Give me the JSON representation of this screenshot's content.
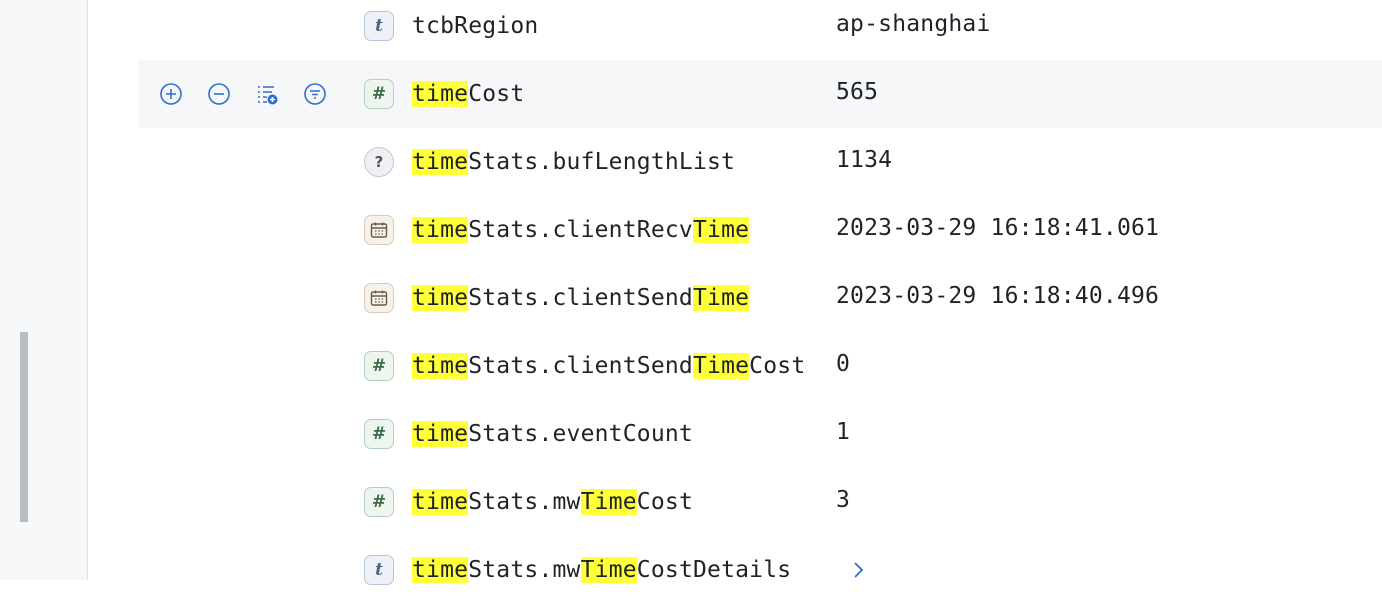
{
  "actions": [
    {
      "icon": "plus-circle-icon"
    },
    {
      "icon": "minus-circle-icon"
    },
    {
      "icon": "add-to-list-icon"
    },
    {
      "icon": "filter-icon"
    }
  ],
  "highlight_term": "time",
  "colors": {
    "highlight": "#ffff3a",
    "action_blue": "#2f6fd0"
  },
  "rows": [
    {
      "type": "text",
      "icon": "t",
      "field": [
        {
          "t": "tcbRegion",
          "h": false
        }
      ],
      "value": "ap-shanghai"
    },
    {
      "type": "number",
      "icon": "#",
      "field": [
        {
          "t": "time",
          "h": true
        },
        {
          "t": "Cost",
          "h": false
        }
      ],
      "value": "565"
    },
    {
      "type": "unknown",
      "icon": "?",
      "field": [
        {
          "t": "time",
          "h": true
        },
        {
          "t": "Stats.bufLengthList",
          "h": false
        }
      ],
      "value": "1134"
    },
    {
      "type": "date",
      "icon": "calendar-icon",
      "field": [
        {
          "t": "time",
          "h": true
        },
        {
          "t": "Stats.clientRecv",
          "h": false
        },
        {
          "t": "Time",
          "h": true
        }
      ],
      "value": "2023-03-29 16:18:41.061"
    },
    {
      "type": "date",
      "icon": "calendar-icon",
      "field": [
        {
          "t": "time",
          "h": true
        },
        {
          "t": "Stats.clientSend",
          "h": false
        },
        {
          "t": "Time",
          "h": true
        }
      ],
      "value": "2023-03-29 16:18:40.496"
    },
    {
      "type": "number",
      "icon": "#",
      "field": [
        {
          "t": "time",
          "h": true
        },
        {
          "t": "Stats.clientSend",
          "h": false
        },
        {
          "t": "Time",
          "h": true
        },
        {
          "t": "Cost",
          "h": false
        }
      ],
      "value": "0"
    },
    {
      "type": "number",
      "icon": "#",
      "field": [
        {
          "t": "time",
          "h": true
        },
        {
          "t": "Stats.eventCount",
          "h": false
        }
      ],
      "value": "1"
    },
    {
      "type": "number",
      "icon": "#",
      "field": [
        {
          "t": "time",
          "h": true
        },
        {
          "t": "Stats.mw",
          "h": false
        },
        {
          "t": "Time",
          "h": true
        },
        {
          "t": "Cost",
          "h": false
        }
      ],
      "value": "3"
    },
    {
      "type": "text",
      "icon": "t",
      "field": [
        {
          "t": "time",
          "h": true
        },
        {
          "t": "Stats.mw",
          "h": false
        },
        {
          "t": "Time",
          "h": true
        },
        {
          "t": "CostDetails",
          "h": false
        }
      ],
      "value": "",
      "expandable": true
    }
  ]
}
